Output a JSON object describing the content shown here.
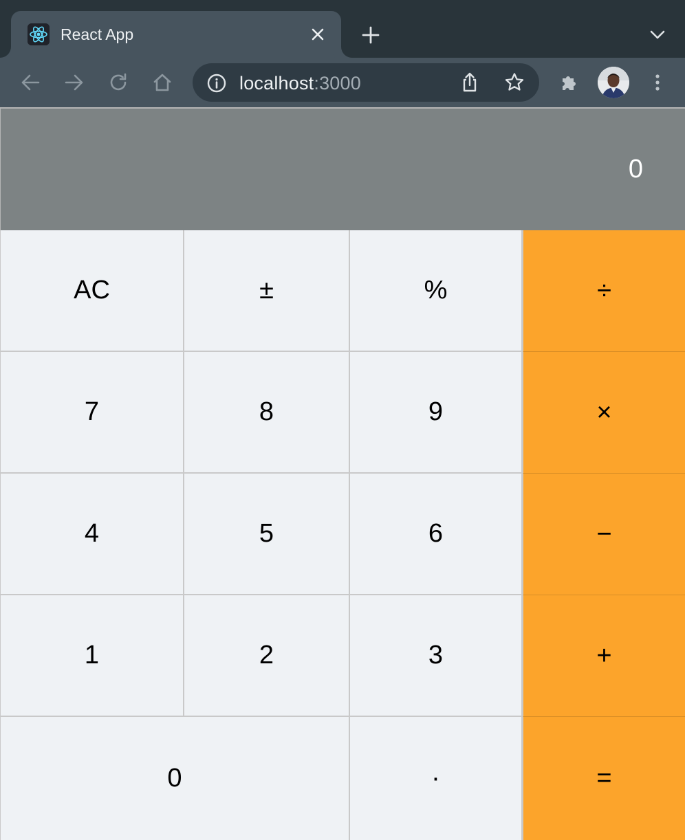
{
  "browser": {
    "tab_title": "React App",
    "url_host": "localhost",
    "url_port": ":3000",
    "favicon": "react-logo-icon",
    "icons": [
      "close-icon",
      "plus-icon",
      "chevron-down-icon",
      "back-arrow-icon",
      "forward-arrow-icon",
      "reload-icon",
      "home-icon",
      "info-icon",
      "share-icon",
      "star-icon",
      "puzzle-icon",
      "avatar",
      "more-vert-icon"
    ]
  },
  "calculator": {
    "display": "0",
    "keys": {
      "ac": "AC",
      "sign": "±",
      "percent": "%",
      "divide": "÷",
      "seven": "7",
      "eight": "8",
      "nine": "9",
      "multiply": "×",
      "four": "4",
      "five": "5",
      "six": "6",
      "subtract": "−",
      "one": "1",
      "two": "2",
      "three": "3",
      "add": "+",
      "zero": "0",
      "decimal": "·",
      "equals": "="
    },
    "colors": {
      "display_bg": "#7d8384",
      "key_bg": "#eff2f5",
      "operator_bg": "#fca42b"
    }
  }
}
